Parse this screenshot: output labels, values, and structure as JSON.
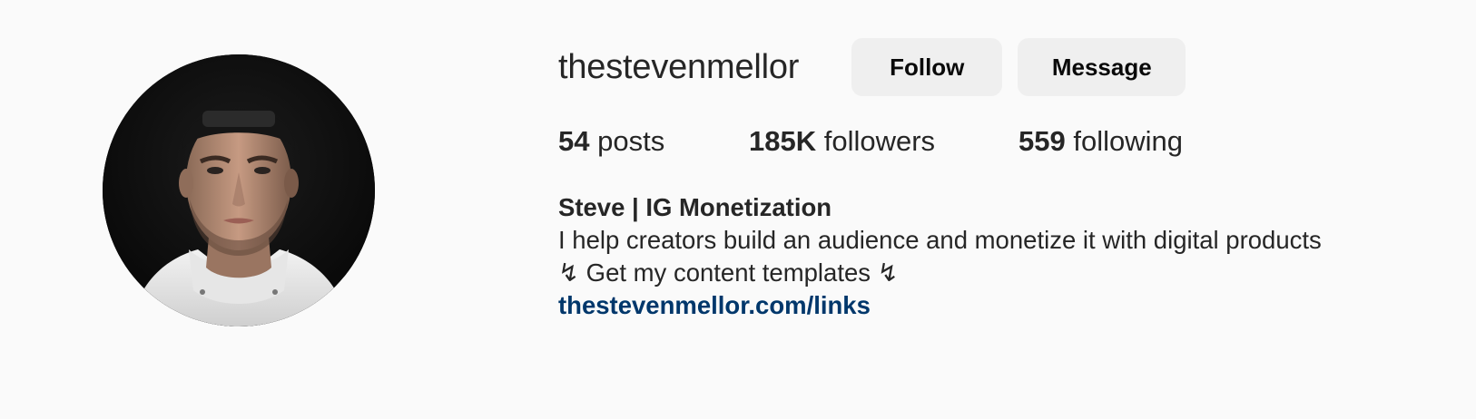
{
  "profile": {
    "username": "thestevenmellor",
    "avatar_icon": "profile-photo"
  },
  "actions": {
    "follow_label": "Follow",
    "message_label": "Message"
  },
  "stats": {
    "posts_count": "54",
    "posts_label": "posts",
    "followers_count": "185K",
    "followers_label": "followers",
    "following_count": "559",
    "following_label": "following"
  },
  "bio": {
    "name": "Steve | IG Monetization",
    "line1": "I help creators build an audience and monetize it with digital products",
    "line2": "↯ Get my content templates ↯",
    "link": "thestevenmellor.com/links"
  },
  "colors": {
    "background": "#fafafa",
    "button_bg": "#efefef",
    "link": "#00376b",
    "text": "#262626"
  }
}
